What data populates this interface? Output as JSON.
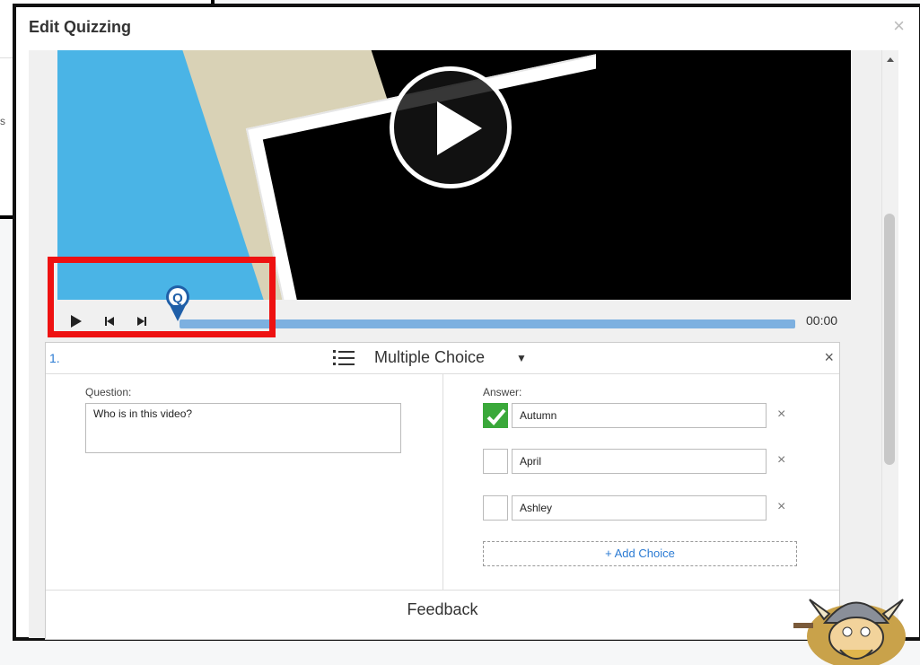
{
  "background": {
    "fragment_text": "s"
  },
  "modal": {
    "title": "Edit Quizzing",
    "close_icon": "×"
  },
  "player": {
    "time": "00:00",
    "marker_label": "Q",
    "icons": [
      "play-icon",
      "skip-back-icon",
      "skip-forward-icon"
    ]
  },
  "question": {
    "number": "1.",
    "type": "Multiple Choice",
    "type_caret": "▼",
    "remove": "×",
    "question_label": "Question:",
    "question_text": "Who is in this video?",
    "answer_label": "Answer:",
    "choices": [
      {
        "text": "Autumn",
        "correct": true
      },
      {
        "text": "April",
        "correct": false
      },
      {
        "text": "Ashley",
        "correct": false
      }
    ],
    "choice_remove": "×",
    "add_choice": "+ Add Choice",
    "feedback": "Feedback"
  },
  "colors": {
    "accent_blue": "#2b7bd3",
    "progress_blue": "#7db0e0",
    "correct_green": "#3aa83a",
    "highlight_red": "#ee1111"
  }
}
